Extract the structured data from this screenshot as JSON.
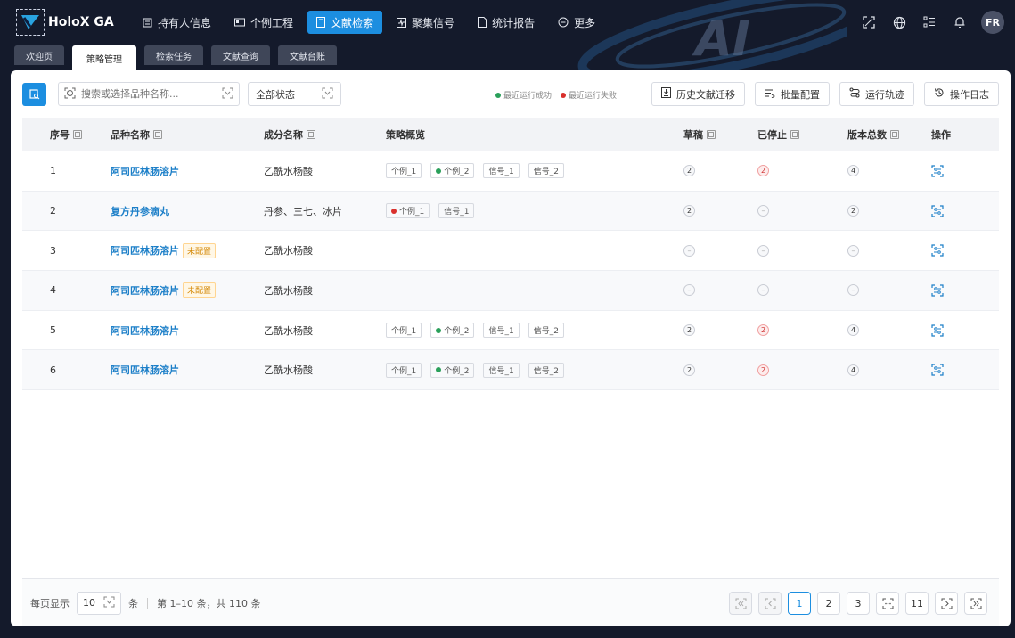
{
  "app": {
    "name": "HoloX GA"
  },
  "nav": [
    {
      "label": "持有人信息",
      "icon": "building-icon"
    },
    {
      "label": "个例工程",
      "icon": "id-card-icon"
    },
    {
      "label": "文献检索",
      "icon": "book-icon",
      "active": true
    },
    {
      "label": "聚集信号",
      "icon": "pulse-icon"
    },
    {
      "label": "统计报告",
      "icon": "report-icon"
    },
    {
      "label": "更多",
      "icon": "more-icon"
    }
  ],
  "user": {
    "initials": "FR"
  },
  "tabs": [
    {
      "label": "欢迎页"
    },
    {
      "label": "策略管理",
      "active": true
    },
    {
      "label": "检索任务"
    },
    {
      "label": "文献查询"
    },
    {
      "label": "文献台账"
    }
  ],
  "toolbar": {
    "search_placeholder": "搜索或选择品种名称...",
    "status_value": "全部状态",
    "legend_success": "最近运行成功",
    "legend_fail": "最近运行失败",
    "history_label": "历史文献迁移",
    "batch_label": "批量配置",
    "trace_label": "运行轨迹",
    "log_label": "操作日志"
  },
  "colors": {
    "primary": "#1c8ee0",
    "success": "#2aa05a",
    "fail": "#d9302c",
    "warn": "#d48806"
  },
  "table": {
    "headers": {
      "index": "序号",
      "name": "品种名称",
      "ingredient": "成分名称",
      "overview": "策略概览",
      "draft": "草稿",
      "stopped": "已停止",
      "versions": "版本总数",
      "ops": "操作"
    },
    "rows": [
      {
        "index": "1",
        "name": "阿司匹林肠溶片",
        "badge": "",
        "ingredient": "乙酰水杨酸",
        "chips": [
          {
            "label": "个例_1",
            "dot": ""
          },
          {
            "label": "个例_2",
            "dot": "green"
          },
          {
            "label": "信号_1",
            "dot": ""
          },
          {
            "label": "信号_2",
            "dot": ""
          }
        ],
        "draft": "2",
        "stopped": "2",
        "stopped_red": true,
        "versions": "4"
      },
      {
        "index": "2",
        "name": "复方丹参滴丸",
        "badge": "",
        "ingredient": "丹参、三七、冰片",
        "chips": [
          {
            "label": "个例_1",
            "dot": "red"
          },
          {
            "label": "信号_1",
            "dot": ""
          }
        ],
        "draft": "2",
        "stopped": "–",
        "stopped_red": false,
        "versions": "2"
      },
      {
        "index": "3",
        "name": "阿司匹林肠溶片",
        "badge": "未配置",
        "ingredient": "乙酰水杨酸",
        "chips": [],
        "draft": "–",
        "stopped": "–",
        "stopped_red": false,
        "versions": "–"
      },
      {
        "index": "4",
        "name": "阿司匹林肠溶片",
        "badge": "未配置",
        "ingredient": "乙酰水杨酸",
        "chips": [],
        "draft": "–",
        "stopped": "–",
        "stopped_red": false,
        "versions": "–"
      },
      {
        "index": "5",
        "name": "阿司匹林肠溶片",
        "badge": "",
        "ingredient": "乙酰水杨酸",
        "chips": [
          {
            "label": "个例_1",
            "dot": ""
          },
          {
            "label": "个例_2",
            "dot": "green"
          },
          {
            "label": "信号_1",
            "dot": ""
          },
          {
            "label": "信号_2",
            "dot": ""
          }
        ],
        "draft": "2",
        "stopped": "2",
        "stopped_red": true,
        "versions": "4"
      },
      {
        "index": "6",
        "name": "阿司匹林肠溶片",
        "badge": "",
        "ingredient": "乙酰水杨酸",
        "chips": [
          {
            "label": "个例_1",
            "dot": ""
          },
          {
            "label": "个例_2",
            "dot": "green"
          },
          {
            "label": "信号_1",
            "dot": ""
          },
          {
            "label": "信号_2",
            "dot": ""
          }
        ],
        "draft": "2",
        "stopped": "2",
        "stopped_red": true,
        "versions": "4"
      }
    ]
  },
  "footer": {
    "per_page_label": "每页显示",
    "per_page_value": "10",
    "per_page_unit": "条",
    "summary": "第 1–10 条，共 110 条",
    "pages": [
      "1",
      "2",
      "3"
    ],
    "last_page": "11"
  }
}
